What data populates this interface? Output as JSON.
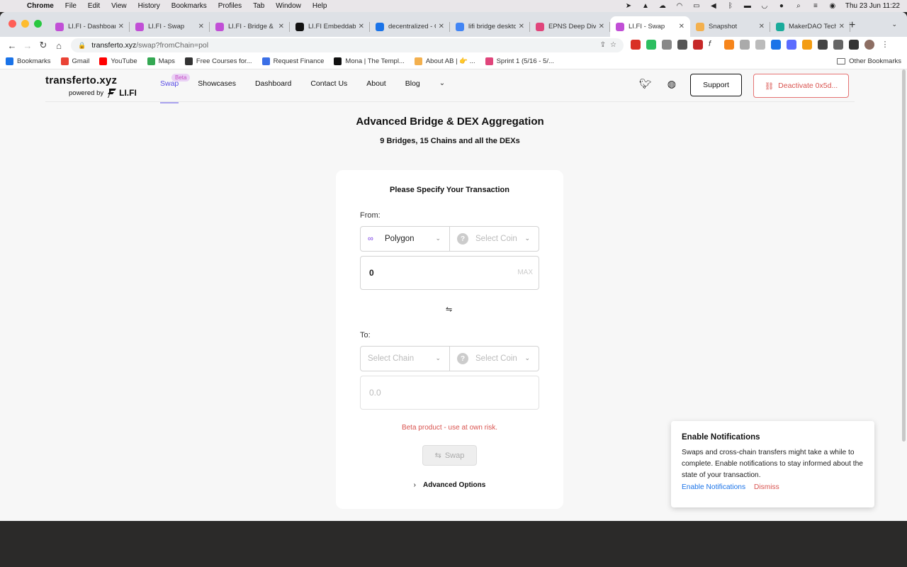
{
  "menubar": {
    "app": "Chrome",
    "items": [
      "File",
      "Edit",
      "View",
      "History",
      "Bookmarks",
      "Profiles",
      "Tab",
      "Window",
      "Help"
    ],
    "datetime": "Thu 23 Jun  11:22"
  },
  "tabs": [
    {
      "title": "LI.FI - Dashboard",
      "favicon_color": "#c14fd6",
      "active": false
    },
    {
      "title": "LI.FI - Swap",
      "favicon_color": "#c14fd6",
      "active": false
    },
    {
      "title": "LI.FI - Bridge & DEX",
      "favicon_color": "#c14fd6",
      "active": false
    },
    {
      "title": "LI.FI Embeddable",
      "favicon_color": "#111111",
      "active": false
    },
    {
      "title": "decentralized - Google",
      "favicon_color": "#1a73e8",
      "active": false
    },
    {
      "title": "lifi bridge desktop",
      "favicon_color": "#4285f4",
      "active": false
    },
    {
      "title": "EPNS Deep Dive",
      "favicon_color": "#e0457b",
      "active": false
    },
    {
      "title": "LI.FI - Swap",
      "favicon_color": "#c14fd6",
      "active": true
    },
    {
      "title": "Snapshot",
      "favicon_color": "#f3b04e",
      "active": false
    },
    {
      "title": "MakerDAO Tech",
      "favicon_color": "#1aab9b",
      "active": false
    }
  ],
  "omnibox": {
    "host": "transferto.xyz",
    "path": "/swap?fromChain=pol"
  },
  "bookmarks": [
    {
      "label": "Bookmarks",
      "color": "#1a73e8"
    },
    {
      "label": "Gmail",
      "color": "#ea4335"
    },
    {
      "label": "YouTube",
      "color": "#ff0000"
    },
    {
      "label": "Maps",
      "color": "#34a853"
    },
    {
      "label": "Free Courses for...",
      "color": "#333333"
    },
    {
      "label": "Request Finance",
      "color": "#3b6fe6"
    },
    {
      "label": "Mona | The Templ...",
      "color": "#111111"
    },
    {
      "label": "About AB | 👉 ...",
      "color": "#f3b04e"
    },
    {
      "label": "Sprint 1 (5/16 - 5/...",
      "color": "#e0457b"
    }
  ],
  "other_bookmarks": "Other Bookmarks",
  "site": {
    "brand": "transferto.xyz",
    "powered_by": "powered by",
    "powered_brand": "LI.FI",
    "beta_badge": "Beta",
    "nav": [
      "Swap",
      "Showcases",
      "Dashboard",
      "Contact Us",
      "About",
      "Blog"
    ],
    "support": "Support",
    "deactivate": "Deactivate 0x5d...",
    "title": "Advanced Bridge & DEX Aggregation",
    "subtitle": "9 Bridges, 15 Chains and all the DEXs"
  },
  "card": {
    "title": "Please Specify Your Transaction",
    "from_label": "From:",
    "from_chain": "Polygon",
    "from_coin_placeholder": "Select Coin",
    "from_amount": "0",
    "max": "MAX",
    "to_label": "To:",
    "to_chain_placeholder": "Select Chain",
    "to_coin_placeholder": "Select Coin",
    "to_amount_placeholder": "0.0",
    "risk": "Beta product - use at own risk.",
    "swap": "Swap",
    "advanced": "Advanced Options"
  },
  "toast": {
    "title": "Enable Notifications",
    "body": "Swaps and cross-chain transfers might take a while to complete. Enable notifications to stay informed about the state of your transaction.",
    "enable": "Enable Notifications",
    "dismiss": "Dismiss"
  }
}
